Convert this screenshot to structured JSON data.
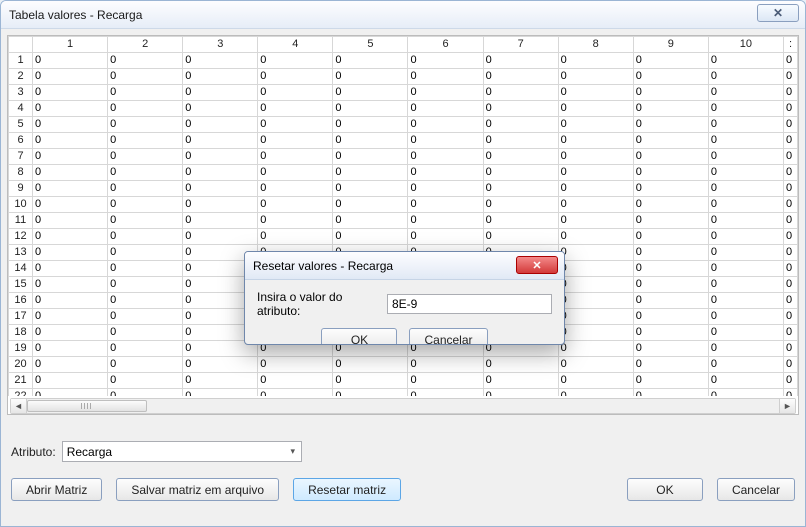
{
  "window": {
    "title": "Tabela valores - Recarga",
    "close_glyph": "✕"
  },
  "grid": {
    "col_count": 10,
    "row_count": 22,
    "cell_value": "0"
  },
  "controls": {
    "attribute_label": "Atributo:",
    "attribute_value": "Recarga",
    "open_matrix": "Abrir Matriz",
    "save_matrix": "Salvar matriz em arquivo",
    "reset_matrix": "Resetar matriz",
    "ok": "OK",
    "cancel": "Cancelar"
  },
  "modal": {
    "title": "Resetar valores - Recarga",
    "close_glyph": "✕",
    "prompt": "Insira o valor do atributo:",
    "input_value": "8E-9",
    "ok": "OK",
    "cancel": "Cancelar"
  }
}
